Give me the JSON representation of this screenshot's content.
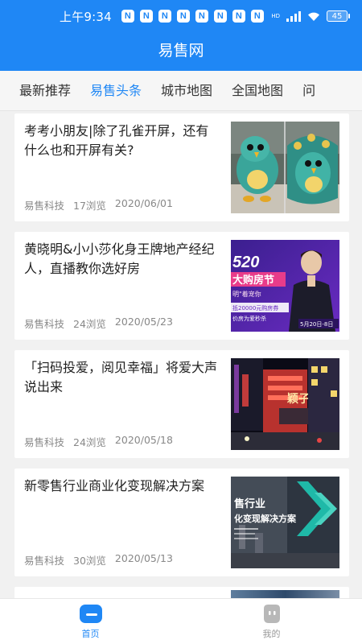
{
  "status": {
    "time": "上午9:34",
    "notif_letter": "N",
    "notif_count": 8,
    "hd": "HD",
    "battery": "45"
  },
  "app": {
    "title": "易售网"
  },
  "tabs": [
    {
      "label": "最新推荐",
      "active": false
    },
    {
      "label": "易售头条",
      "active": true
    },
    {
      "label": "城市地图",
      "active": false
    },
    {
      "label": "全国地图",
      "active": false
    },
    {
      "label": "问",
      "active": false
    }
  ],
  "articles": [
    {
      "title": "考考小朋友|除了孔雀开屏，还有什么也和开屏有关?",
      "source": "易售科技",
      "views": "17浏览",
      "date": "2020/06/01",
      "thumb": "peacock-plush-image"
    },
    {
      "title": "黄晓明&小小莎化身王牌地产经纪人，直播教你选好房",
      "source": "易售科技",
      "views": "24浏览",
      "date": "2020/05/23",
      "thumb": "520-shopping-festival-banner",
      "thumb_text": {
        "num": "520",
        "festival": "大购房节",
        "line2": "明\"着宠你",
        "line3": "抵20000元购房券",
        "line4": "价房为爱秒杀",
        "date": "5月20日-8日"
      }
    },
    {
      "title": "「扫码投爱，阅见幸福」将爱大声说出来",
      "source": "易售科技",
      "views": "24浏览",
      "date": "2020/05/18",
      "thumb": "night-city-street-image",
      "thumb_text": {
        "sign": "颖子"
      }
    },
    {
      "title": "新零售行业商业化变现解决方案",
      "source": "易售科技",
      "views": "30浏览",
      "date": "2020/05/13",
      "thumb": "new-retail-solution-banner",
      "thumb_text": {
        "line1": "售行业",
        "line2": "化变现解决方案"
      }
    }
  ],
  "bottom_nav": [
    {
      "label": "首页",
      "icon": "home-icon",
      "active": true
    },
    {
      "label": "我的",
      "icon": "profile-icon",
      "active": false
    }
  ],
  "colors": {
    "primary": "#1f87f5",
    "inactive": "#999999"
  }
}
